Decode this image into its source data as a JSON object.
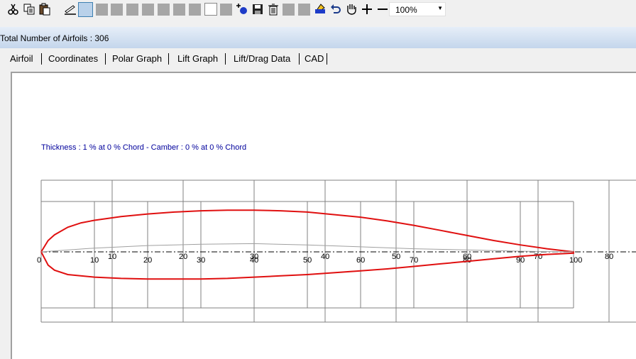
{
  "toolbar": {
    "buttons": [
      "cut-icon",
      "copy-icon",
      "paste-icon",
      "pen-icon",
      "select-icon",
      "blank",
      "blank",
      "blank",
      "blank",
      "blank",
      "blank",
      "blank",
      "blank",
      "blank",
      "add-point-icon",
      "save-icon",
      "delete-icon",
      "blank",
      "blank",
      "fill-icon",
      "undo-icon",
      "pan-hand-icon",
      "zoom-in-icon",
      "zoom-out-icon"
    ],
    "zoom_value": "100%"
  },
  "header": {
    "total_label": "Total Number of Airfoils : 306"
  },
  "tabs": [
    {
      "label": "Airfoil"
    },
    {
      "label": "Coordinates"
    },
    {
      "label": "Polar Graph"
    },
    {
      "label": "Lift Graph"
    },
    {
      "label": "Lift/Drag Data"
    },
    {
      "label": "CAD"
    }
  ],
  "info": {
    "text": "Thickness : 1 % at 0 % Chord - Camber : 0 % at 0 % Chord"
  },
  "colors": {
    "airfoil": "#e01010",
    "text_blue": "#00009c",
    "grid": "#808080"
  },
  "chart_data": {
    "type": "line",
    "inner_axis_ticks": [
      "0",
      "10",
      "20",
      "30",
      "40",
      "50",
      "60",
      "70",
      "80",
      "90",
      "100"
    ],
    "outer_axis_ticks": [
      "0",
      "10",
      "20",
      "30",
      "40",
      "50",
      "60",
      "70",
      "80"
    ],
    "series": [
      {
        "values": [
          [
            0,
            0
          ],
          [
            1.3,
            1.8
          ],
          [
            2.5,
            2.7
          ],
          [
            5,
            3.9
          ],
          [
            7.5,
            4.6
          ],
          [
            10,
            5.0
          ],
          [
            15,
            5.6
          ],
          [
            20,
            6.0
          ],
          [
            25,
            6.3
          ],
          [
            30,
            6.5
          ],
          [
            35,
            6.6
          ],
          [
            40,
            6.6
          ],
          [
            45,
            6.5
          ],
          [
            50,
            6.3
          ],
          [
            55,
            5.9
          ],
          [
            60,
            5.5
          ],
          [
            65,
            4.9
          ],
          [
            70,
            4.2
          ],
          [
            75,
            3.4
          ],
          [
            80,
            2.6
          ],
          [
            85,
            1.8
          ],
          [
            90,
            1.1
          ],
          [
            95,
            0.5
          ],
          [
            100,
            0
          ],
          [
            100,
            -0.2
          ],
          [
            95,
            -0.4
          ],
          [
            90,
            -0.7
          ],
          [
            85,
            -1.1
          ],
          [
            80,
            -1.5
          ],
          [
            75,
            -1.9
          ],
          [
            70,
            -2.3
          ],
          [
            65,
            -2.7
          ],
          [
            60,
            -3.0
          ],
          [
            55,
            -3.3
          ],
          [
            50,
            -3.6
          ],
          [
            45,
            -3.8
          ],
          [
            40,
            -4.0
          ],
          [
            35,
            -4.2
          ],
          [
            30,
            -4.3
          ],
          [
            25,
            -4.3
          ],
          [
            20,
            -4.3
          ],
          [
            15,
            -4.2
          ],
          [
            10,
            -4.0
          ],
          [
            5,
            -3.6
          ],
          [
            2.5,
            -2.9
          ],
          [
            1.3,
            -2.1
          ],
          [
            0,
            0
          ]
        ]
      },
      {
        "values": [
          [
            0,
            0
          ],
          [
            10,
            0.6
          ],
          [
            20,
            1.0
          ],
          [
            30,
            1.2
          ],
          [
            40,
            1.3
          ],
          [
            50,
            1.1
          ],
          [
            60,
            0.8
          ],
          [
            70,
            0.5
          ],
          [
            80,
            0.3
          ],
          [
            90,
            0.1
          ],
          [
            100,
            0
          ]
        ]
      }
    ]
  }
}
